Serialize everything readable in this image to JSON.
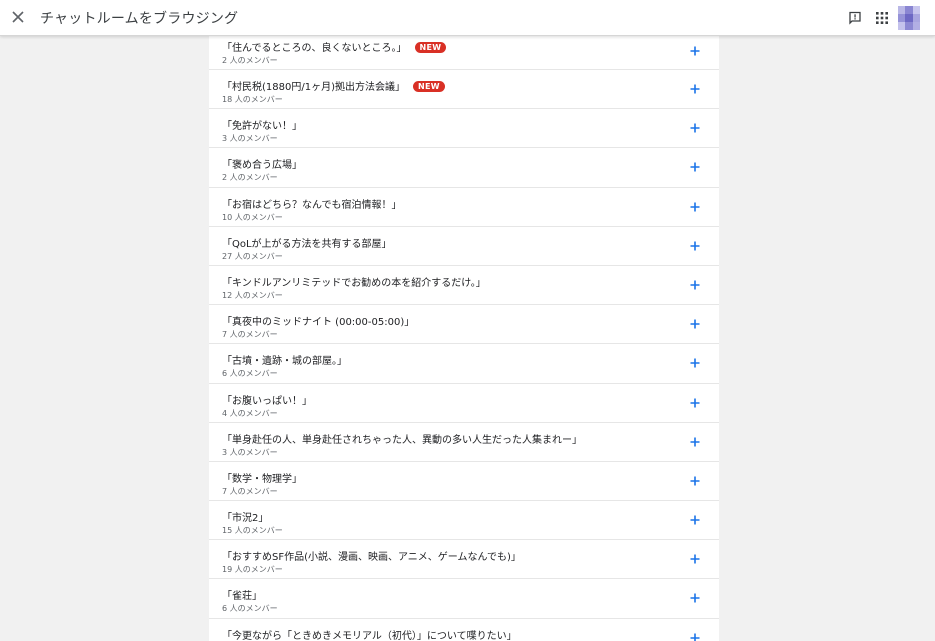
{
  "header": {
    "title": "チャットルームをブラウジング",
    "close_icon": "close-icon",
    "feedback_icon": "feedback-icon",
    "apps_icon": "apps-grid-icon"
  },
  "colors": {
    "accent": "#1a73e8",
    "badge": "#d93025",
    "avatar": [
      "#b9b7e6",
      "#8a86d2",
      "#c8c6ee",
      "#9693d8",
      "#6d68c4",
      "#a9a6e0",
      "#c4c2ec",
      "#8c88d3",
      "#b2afe4"
    ]
  },
  "rooms": [
    {
      "name": "「住んでるところの、良くないところ。」",
      "members": "2 人のメンバー",
      "badge": "NEW"
    },
    {
      "name": "「村民税(1880円/1ヶ月)拠出方法会議」",
      "members": "18 人のメンバー",
      "badge": "NEW"
    },
    {
      "name": "「免許がない！」",
      "members": "3 人のメンバー",
      "badge": ""
    },
    {
      "name": "「褒め合う広場」",
      "members": "2 人のメンバー",
      "badge": ""
    },
    {
      "name": "「お宿はどちら？なんでも宿泊情報！」",
      "members": "10 人のメンバー",
      "badge": ""
    },
    {
      "name": "「QoLが上がる方法を共有する部屋」",
      "members": "27 人のメンバー",
      "badge": ""
    },
    {
      "name": "「キンドルアンリミテッドでお勧めの本を紹介するだけ。」",
      "members": "12 人のメンバー",
      "badge": ""
    },
    {
      "name": "「真夜中のミッドナイト (00:00-05:00)」",
      "members": "7 人のメンバー",
      "badge": ""
    },
    {
      "name": "「古墳・遺跡・城の部屋。」",
      "members": "6 人のメンバー",
      "badge": ""
    },
    {
      "name": "「お腹いっぱい！」",
      "members": "4 人のメンバー",
      "badge": ""
    },
    {
      "name": "「単身赴任の人、単身赴任されちゃった人、異動の多い人生だった人集まれー」",
      "members": "3 人のメンバー",
      "badge": ""
    },
    {
      "name": "「数学・物理学」",
      "members": "7 人のメンバー",
      "badge": ""
    },
    {
      "name": "「市況2」",
      "members": "15 人のメンバー",
      "badge": ""
    },
    {
      "name": "「おすすめSF作品(小説、漫画、映画、アニメ、ゲームなんでも)」",
      "members": "19 人のメンバー",
      "badge": ""
    },
    {
      "name": "「雀荘」",
      "members": "6 人のメンバー",
      "badge": ""
    },
    {
      "name": "「今更ながら「ときめきメモリアル（初代）」について喋りたい」",
      "members": "",
      "badge": ""
    }
  ]
}
